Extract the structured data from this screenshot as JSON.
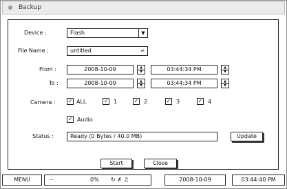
{
  "window": {
    "title": "Backup"
  },
  "form": {
    "device_label": "Device :",
    "device_value": "Flash",
    "filename_label": "File Name :",
    "filename_value": "untitled",
    "from_label": "From :",
    "from_date": "2008-10-09",
    "from_time": "03:44:34 PM",
    "to_label": "To :",
    "to_date": "2008-10-09",
    "to_time": "03:44:34 PM",
    "camera_label": "Camera :",
    "cameras": [
      {
        "label": "ALL",
        "checked": true
      },
      {
        "label": "1",
        "checked": true
      },
      {
        "label": "2",
        "checked": true
      },
      {
        "label": "3",
        "checked": true
      },
      {
        "label": "4",
        "checked": true
      }
    ],
    "audio_label": "Audio",
    "audio_checked": true,
    "status_label": "Status :",
    "status_value": "Ready (0 Bytes / 40.0 MB)"
  },
  "buttons": {
    "update": "Update",
    "start": "Start",
    "close": "Close"
  },
  "statusbar": {
    "menu": "MENU",
    "hdd_label": "---",
    "percent": "0%",
    "icons": "↻ ✗ ♫",
    "date": "2008-10-09",
    "time": "03:44:40 PM"
  }
}
